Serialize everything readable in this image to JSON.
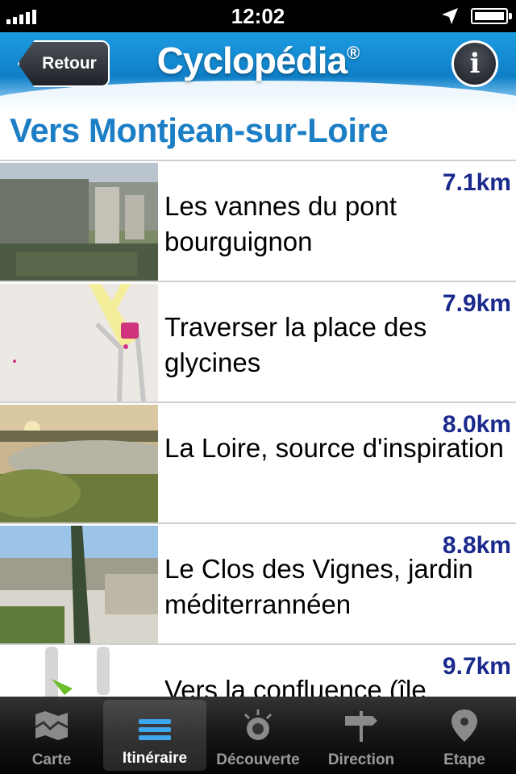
{
  "status_bar": {
    "time": "12:02"
  },
  "header": {
    "back_label": "Retour",
    "brand": "Cyclopédia",
    "brand_mark": "®",
    "info_label": "i"
  },
  "page_title": "Vers Montjean-sur-Loire",
  "items": [
    {
      "title": "Les vannes du pont bourguignon",
      "distance": "7.1km"
    },
    {
      "title": "Traverser la place des glycines",
      "distance": "7.9km"
    },
    {
      "title": "La Loire, source d'inspiration",
      "distance": "8.0km"
    },
    {
      "title": "Le Clos des Vignes, jardin méditerrannéen",
      "distance": "8.8km"
    },
    {
      "title": "Vers la confluence (île",
      "distance": "9.7km"
    }
  ],
  "tabs": [
    {
      "label": "Carte",
      "icon": "map-icon"
    },
    {
      "label": "Itinéraire",
      "icon": "list-icon"
    },
    {
      "label": "Découverte",
      "icon": "discovery-icon"
    },
    {
      "label": "Direction",
      "icon": "signpost-icon"
    },
    {
      "label": "Etape",
      "icon": "location-pin-icon"
    }
  ],
  "active_tab": "Itinéraire",
  "colors": {
    "header_blue": "#1d9be0",
    "title_blue": "#1c7fc6",
    "distance_navy": "#1a2a8c"
  }
}
